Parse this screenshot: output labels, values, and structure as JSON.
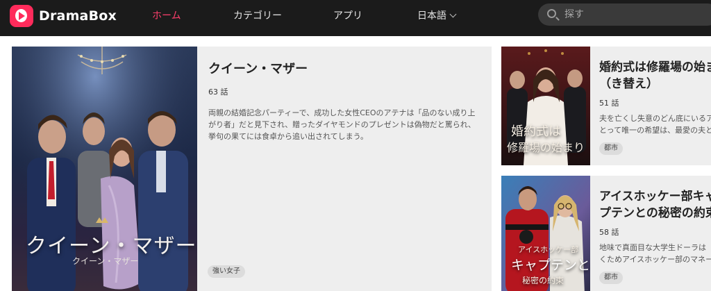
{
  "header": {
    "logo_text": "DramaBox",
    "nav": [
      "ホーム",
      "カテゴリー",
      "アプリ"
    ],
    "language": "日本語",
    "search_placeholder": "探す"
  },
  "featured": {
    "title": "クイーン・マザー",
    "episodes": "63 話",
    "description": "両親の結婚記念パーティーで、成功した女性CEOのアテナは「品のない成り上がり者」だと見下され、贈ったダイヤモンドのプレゼントは偽物だと罵られ、挙句の果てには食卓から追い出されてしまう。",
    "tag": "強い女子",
    "poster_title": "クイーン・マザー",
    "poster_subtitle": "クイーン・マザー"
  },
  "side": [
    {
      "title": "婚約式は修羅場の始まり（き替え）",
      "episodes": "51 話",
      "desc_line1": "夫を亡くし失意のどん底にいるア",
      "desc_line2": "とって唯一の希望は、最愛の夫と",
      "tag": "都市",
      "poster_line1": "婚約式は",
      "poster_line2": "修羅場の始まり"
    },
    {
      "title": "アイスホッケー部キャプテンとの秘密の約束",
      "episodes": "58 話",
      "desc_line1": "地味で真面目な大学生ドーラは",
      "desc_line2": "くためアイスホッケー部のマネー",
      "tag": "都市",
      "poster_line1": "アイスホッケー部",
      "poster_line2": "キャプテンとの",
      "poster_line3": "秘密の約束"
    }
  ],
  "colors": {
    "nav_bg": "#1b1b1b",
    "accent": "#ff3f6c",
    "card_bg": "#eeeeee"
  }
}
